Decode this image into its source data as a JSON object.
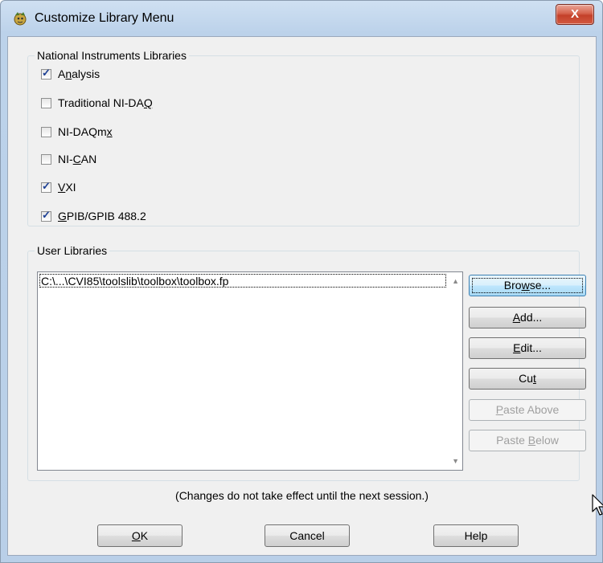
{
  "window": {
    "title": "Customize Library Menu",
    "close_label": "X"
  },
  "ni_libraries": {
    "title": "National Instruments Libraries",
    "items": [
      {
        "pre": "A",
        "mn": "n",
        "post": "alysis",
        "checked": true
      },
      {
        "pre": "Traditional NI-DA",
        "mn": "Q",
        "post": "",
        "checked": false
      },
      {
        "pre": "NI-DAQm",
        "mn": "x",
        "post": "",
        "checked": false
      },
      {
        "pre": "NI-",
        "mn": "C",
        "post": "AN",
        "checked": false
      },
      {
        "pre": "",
        "mn": "V",
        "post": "XI",
        "checked": true
      },
      {
        "pre": "",
        "mn": "G",
        "post": "PIB/GPIB 488.2",
        "checked": true
      }
    ]
  },
  "user_libraries": {
    "title": "User Libraries",
    "items": [
      "C:\\...\\CVI85\\toolslib\\toolbox\\toolbox.fp"
    ],
    "buttons": [
      {
        "pre": "Bro",
        "mn": "w",
        "post": "se...",
        "enabled": true,
        "focused": true
      },
      {
        "pre": "",
        "mn": "A",
        "post": "dd...",
        "enabled": true,
        "focused": false
      },
      {
        "pre": "",
        "mn": "E",
        "post": "dit...",
        "enabled": true,
        "focused": false
      },
      {
        "pre": "Cu",
        "mn": "t",
        "post": "",
        "enabled": true,
        "focused": false
      },
      {
        "pre": "",
        "mn": "P",
        "post": "aste Above",
        "enabled": false,
        "focused": false
      },
      {
        "pre": "Paste ",
        "mn": "B",
        "post": "elow",
        "enabled": false,
        "focused": false
      }
    ]
  },
  "note": "(Changes do not take effect until the next session.)",
  "dialog_buttons": {
    "ok": {
      "pre": "",
      "mn": "O",
      "post": "K"
    },
    "cancel": {
      "pre": "Cancel",
      "mn": "",
      "post": ""
    },
    "help": {
      "pre": "Help",
      "mn": "",
      "post": ""
    }
  },
  "colors": {
    "title_bar": "#bcd2ea",
    "close_button": "#c3402a",
    "dialog_bg": "#f0f0f0",
    "focused_button": "#bee6fd",
    "check_mark": "#1c3f94"
  }
}
